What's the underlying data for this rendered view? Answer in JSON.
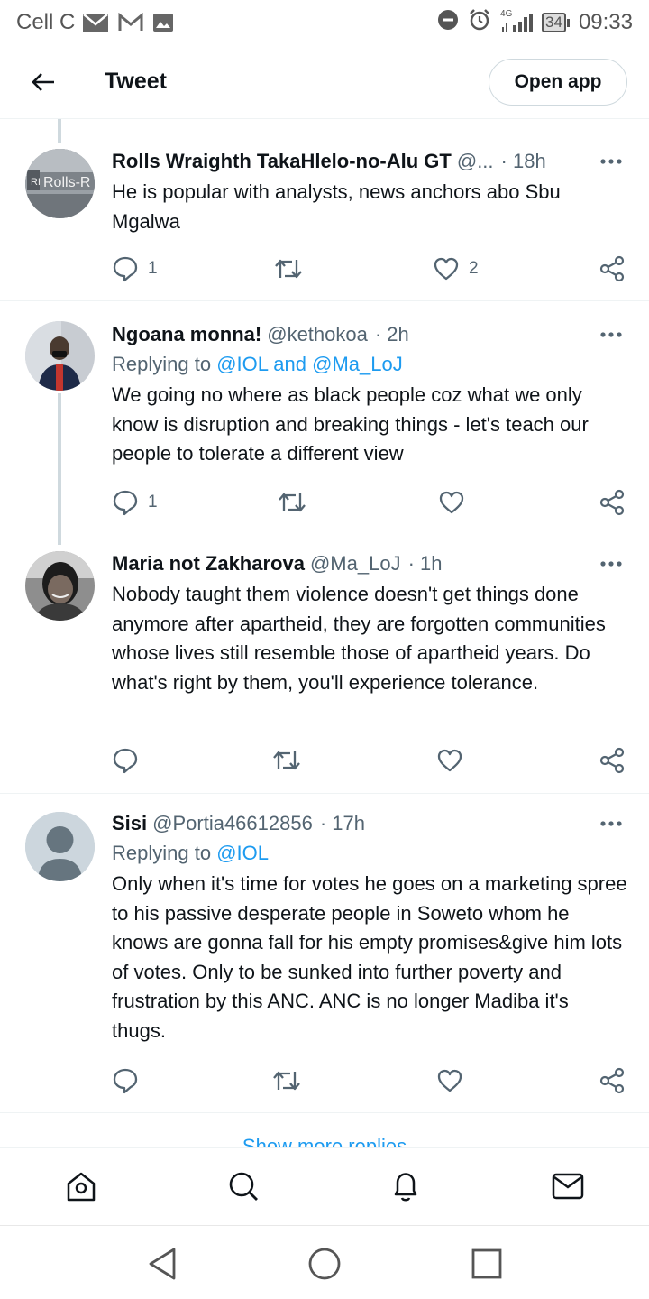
{
  "status_bar": {
    "carrier": "Cell C",
    "battery": "34",
    "time": "09:33",
    "network": "4G"
  },
  "header": {
    "title": "Tweet",
    "open_app_label": "Open app"
  },
  "tweets": [
    {
      "name": "Rolls Wraighth TakaHlelo-no-Alu GT",
      "handle": "@...",
      "time": "· 18h",
      "text": "He is popular with analysts, news anchors abo Sbu Mgalwa",
      "replies": "1",
      "retweets": "",
      "likes": "2",
      "avatar_text": "Rolls-R"
    },
    {
      "name": "Ngoana monna!",
      "handle": "@kethokoa",
      "time": "· 2h",
      "replying_prefix": "Replying to",
      "replying_to": "@IOL and @Ma_LoJ",
      "text": "We going no where as black people coz what we only know is disruption and breaking things - let's teach our people to tolerate a different view",
      "replies": "1",
      "retweets": "",
      "likes": ""
    },
    {
      "name": "Maria not Zakharova",
      "handle": "@Ma_LoJ",
      "time": "· 1h",
      "text": "Nobody taught them violence doesn't get things done anymore after apartheid, they are forgotten communities whose lives still resemble those of apartheid years. Do what's right by them, you'll experience tolerance.",
      "replies": "",
      "retweets": "",
      "likes": ""
    },
    {
      "name": "Sisi",
      "handle": "@Portia46612856",
      "time": "· 17h",
      "replying_prefix": "Replying to",
      "replying_to": "@IOL",
      "text": "Only when it's time for votes he goes on a marketing spree to his passive desperate people in Soweto whom he knows are gonna fall for his empty promises&give him lots of votes. Only to be sunked into further poverty and frustration by this ANC. ANC is no longer Madiba it's thugs.",
      "replies": "",
      "retweets": "",
      "likes": ""
    }
  ],
  "show_more_label": "Show more replies",
  "bottom_nav": [
    "home-icon",
    "search-icon",
    "bell-icon",
    "mail-icon"
  ],
  "system_nav": [
    "back-triangle-icon",
    "home-circle-icon",
    "recents-square-icon"
  ],
  "colors": {
    "link": "#1d9bf0",
    "text": "#0f1419",
    "secondary": "#536471",
    "divider": "#eff3f4"
  }
}
